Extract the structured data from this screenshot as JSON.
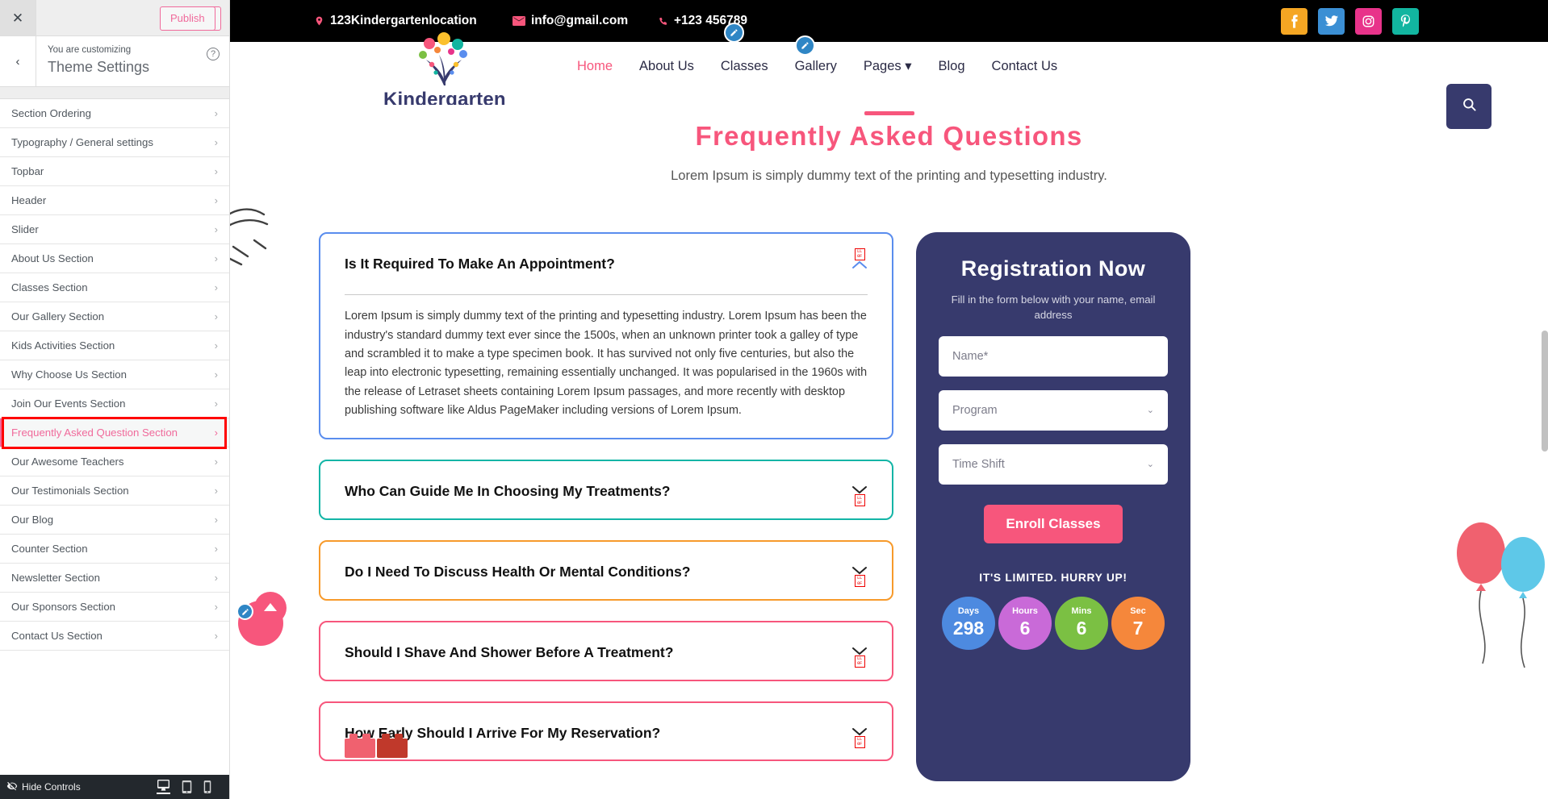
{
  "customizer": {
    "close_label": "✕",
    "back_label": "‹",
    "publish_label": "Publish",
    "gear_icon": "gear-icon",
    "help_label": "?",
    "customizing_label": "You are customizing",
    "panel_title": "Theme Settings",
    "items": [
      {
        "label": "Section Ordering"
      },
      {
        "label": "Typography / General settings"
      },
      {
        "label": "Topbar"
      },
      {
        "label": "Header"
      },
      {
        "label": "Slider"
      },
      {
        "label": "About Us Section"
      },
      {
        "label": "Classes Section"
      },
      {
        "label": "Our Gallery Section"
      },
      {
        "label": "Kids Activities Section"
      },
      {
        "label": "Why Choose Us Section"
      },
      {
        "label": "Join Our Events Section"
      },
      {
        "label": "Frequently Asked Question Section",
        "active": true
      },
      {
        "label": "Our Awesome Teachers"
      },
      {
        "label": "Our Testimonials Section"
      },
      {
        "label": "Our Blog"
      },
      {
        "label": "Counter Section"
      },
      {
        "label": "Newsletter Section"
      },
      {
        "label": "Our Sponsors Section"
      },
      {
        "label": "Contact Us Section"
      }
    ],
    "footer": {
      "hide_controls_label": "Hide Controls",
      "eye_icon": "eye-slash-icon",
      "devices": [
        {
          "name": "desktop",
          "icon": "desktop-icon",
          "active": true
        },
        {
          "name": "tablet",
          "icon": "tablet-icon",
          "active": false
        },
        {
          "name": "mobile",
          "icon": "mobile-icon",
          "active": false
        }
      ]
    }
  },
  "site": {
    "topbar": {
      "location": "123Kindergartenlocation",
      "email": "info@gmail.com",
      "phone": "+123 456789",
      "socials": [
        {
          "name": "facebook",
          "glyph": "f",
          "color": "#f5a623"
        },
        {
          "name": "twitter",
          "glyph": "t",
          "color": "#3b8fd4"
        },
        {
          "name": "instagram",
          "glyph": "◙",
          "color": "#e8338a"
        },
        {
          "name": "pinterest",
          "glyph": "P",
          "color": "#12b5a0"
        }
      ]
    },
    "logo_text": "Kindergarten",
    "nav": [
      {
        "label": "Home",
        "current": true
      },
      {
        "label": "About Us",
        "current": false
      },
      {
        "label": "Classes",
        "current": false
      },
      {
        "label": "Gallery",
        "current": false
      },
      {
        "label": "Pages",
        "current": false,
        "caret": "▾"
      },
      {
        "label": "Blog",
        "current": false
      },
      {
        "label": "Contact Us",
        "current": false
      }
    ],
    "search_icon": "search-icon",
    "faq": {
      "title": "Frequently Asked Questions",
      "subtitle": "Lorem Ipsum is simply dummy text of the printing and typesetting industry.",
      "items": [
        {
          "question": "Is It Required To Make An Appointment?",
          "answer": "Lorem Ipsum is simply dummy text of the printing and typesetting industry. Lorem Ipsum has been the industry's standard dummy text ever since the 1500s, when an unknown printer took a galley of type and scrambled it to make a type specimen book. It has survived not only five centuries, but also the leap into electronic typesetting, remaining essentially unchanged. It was popularised in the 1960s with the release of Letraset sheets containing Lorem Ipsum passages, and more recently with desktop publishing software like Aldus PageMaker including versions of Lorem Ipsum.",
          "open": true,
          "border": "#5a8dee",
          "chevron": "up"
        },
        {
          "question": "Who Can Guide Me In Choosing My Treatments?",
          "answer": "",
          "open": false,
          "border": "#13b5a6",
          "chevron": "down"
        },
        {
          "question": "Do I Need To Discuss Health Or Mental Conditions?",
          "answer": "",
          "open": false,
          "border": "#f79a2b",
          "chevron": "down"
        },
        {
          "question": "Should I Shave And Shower Before A Treatment?",
          "answer": "",
          "open": false,
          "border": "#f7567c",
          "chevron": "down"
        },
        {
          "question": "How Early Should I Arrive For My Reservation?",
          "answer": "",
          "open": false,
          "border": "#f7567c",
          "chevron": "down"
        }
      ]
    },
    "registration": {
      "title": "Registration Now",
      "subtitle": "Fill in the form below with your name, email address",
      "name_placeholder": "Name*",
      "program_placeholder": "Program",
      "timeshift_placeholder": "Time Shift",
      "caret": "⌄",
      "enroll_label": "Enroll Classes",
      "limited_label": "IT'S LIMITED. HURRY UP!",
      "timer": [
        {
          "label": "Days",
          "value": "298",
          "color": "#4d8ae0"
        },
        {
          "label": "Hours",
          "value": "6",
          "color": "#c96ad8"
        },
        {
          "label": "Mins",
          "value": "6",
          "color": "#7bc043"
        },
        {
          "label": "Sec",
          "value": "7",
          "color": "#f5873b"
        }
      ]
    }
  },
  "colors": {
    "accent_pink": "#f7567c",
    "navy": "#373a6d",
    "highlight_red": "#ff0000"
  },
  "edit_pins": [
    {
      "name": "topbar-edit-pin"
    },
    {
      "name": "nav-edit-pin"
    },
    {
      "name": "footer-edit-pin"
    }
  ]
}
